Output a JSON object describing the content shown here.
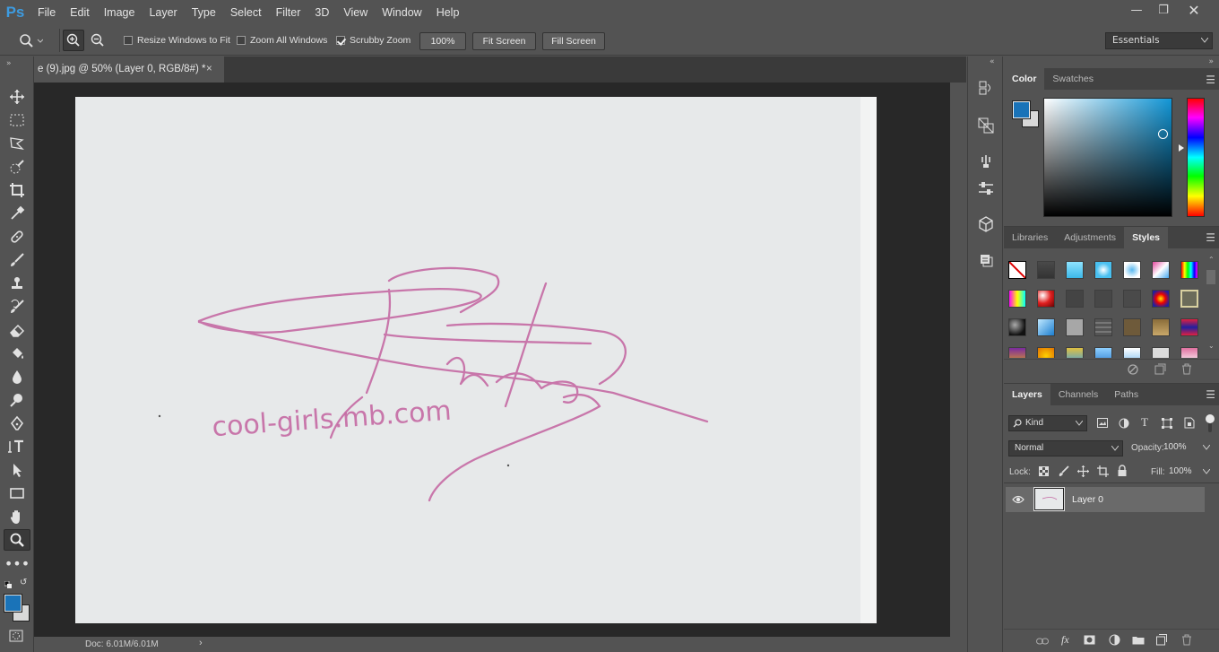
{
  "app": {
    "logo": "Ps"
  },
  "menu": [
    "File",
    "Edit",
    "Image",
    "Layer",
    "Type",
    "Select",
    "Filter",
    "3D",
    "View",
    "Window",
    "Help"
  ],
  "options": {
    "resize_windows": "Resize Windows to Fit",
    "zoom_all": "Zoom All Windows",
    "scrubby_zoom": "Scrubby Zoom",
    "zoom_value": "100%",
    "fit_screen": "Fit Screen",
    "fill_screen": "Fill Screen",
    "workspace": "Essentials"
  },
  "document": {
    "tab_title": "e (9).jpg @ 50% (Layer 0, RGB/8#) *",
    "close": "×",
    "status": "Doc: 6.01M/6.01M",
    "watermark_text": "cool-girls.mb.com"
  },
  "color_panel": {
    "tabs": [
      "Color",
      "Swatches"
    ],
    "fg": "#1a73b8",
    "bg": "#d9d9d9"
  },
  "styles_panel": {
    "tabs": [
      "Libraries",
      "Adjustments",
      "Styles"
    ]
  },
  "layers_panel": {
    "tabs": [
      "Layers",
      "Channels",
      "Paths"
    ],
    "kind": "Kind",
    "blend": "Normal",
    "opacity_label": "Opacity:",
    "opacity": "100%",
    "lock_label": "Lock:",
    "fill_label": "Fill:",
    "fill": "100%",
    "layers": [
      {
        "name": "Layer 0"
      }
    ]
  },
  "colors": {
    "accent": "#3d9be0",
    "ink": "#c45fa0"
  }
}
